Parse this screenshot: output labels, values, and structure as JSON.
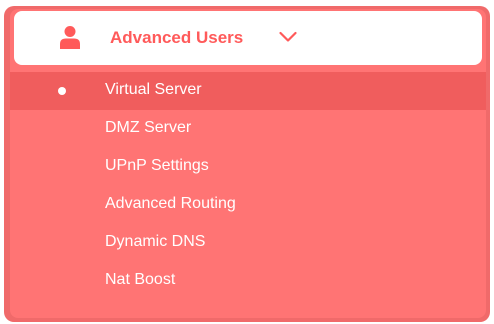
{
  "menu": {
    "header": {
      "label": "Advanced Users",
      "icon": "user-icon",
      "expand_icon": "chevron-down-icon"
    },
    "items": [
      {
        "label": "Virtual Server",
        "active": true
      },
      {
        "label": "DMZ Server",
        "active": false
      },
      {
        "label": "UPnP Settings",
        "active": false
      },
      {
        "label": "Advanced Routing",
        "active": false
      },
      {
        "label": "Dynamic DNS",
        "active": false
      },
      {
        "label": "Nat Boost",
        "active": false
      }
    ]
  },
  "colors": {
    "accent": "#ff5a5a",
    "panel": "#ff7474",
    "active_row": "#f05d5d",
    "frame": "#f06a6a"
  }
}
